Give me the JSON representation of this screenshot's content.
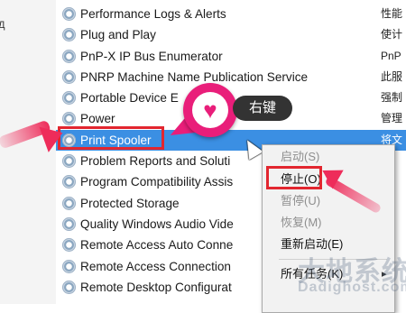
{
  "left_edge": {
    "fragment": "Д"
  },
  "services": [
    {
      "name": "Performance Logs & Alerts",
      "desc": "性能"
    },
    {
      "name": "Plug and Play",
      "desc": "使计"
    },
    {
      "name": "PnP-X IP Bus Enumerator",
      "desc": "PnP"
    },
    {
      "name": "PNRP Machine Name Publication Service",
      "desc": "此服"
    },
    {
      "name": "Portable Device E",
      "desc": "强制"
    },
    {
      "name": "Power",
      "desc": "管理"
    },
    {
      "name": "Print Spooler",
      "desc": "将文"
    },
    {
      "name": "Problem Reports and Soluti",
      "desc": ""
    },
    {
      "name": "Program Compatibility Assis",
      "desc": ""
    },
    {
      "name": "Protected Storage",
      "desc": ""
    },
    {
      "name": "Quality Windows Audio Vide",
      "desc": ""
    },
    {
      "name": "Remote Access Auto Conne",
      "desc": ""
    },
    {
      "name": "Remote Access Connection",
      "desc": ""
    },
    {
      "name": "Remote Desktop Configurat",
      "desc": ""
    }
  ],
  "annotation": {
    "tooltip": "右键",
    "heart_symbol": "♥"
  },
  "context_menu": {
    "items": [
      {
        "label": "启动(S)",
        "disabled": true
      },
      {
        "label": "停止(O)",
        "disabled": false
      },
      {
        "label": "暂停(U)",
        "disabled": true
      },
      {
        "label": "恢复(M)",
        "disabled": true
      },
      {
        "label": "重新启动(E)",
        "disabled": false
      },
      {
        "label": "所有任务(K)",
        "disabled": false,
        "chevron": "▸"
      }
    ]
  },
  "watermark": {
    "line1": "大地系统",
    "line2": "Dadighost.com"
  },
  "colors": {
    "selection": "#3b8fe3",
    "highlight_box": "#e2262f",
    "arrow": "#ee2c5a",
    "badge": "#e91e7a",
    "tooltip_bg": "#333333"
  }
}
